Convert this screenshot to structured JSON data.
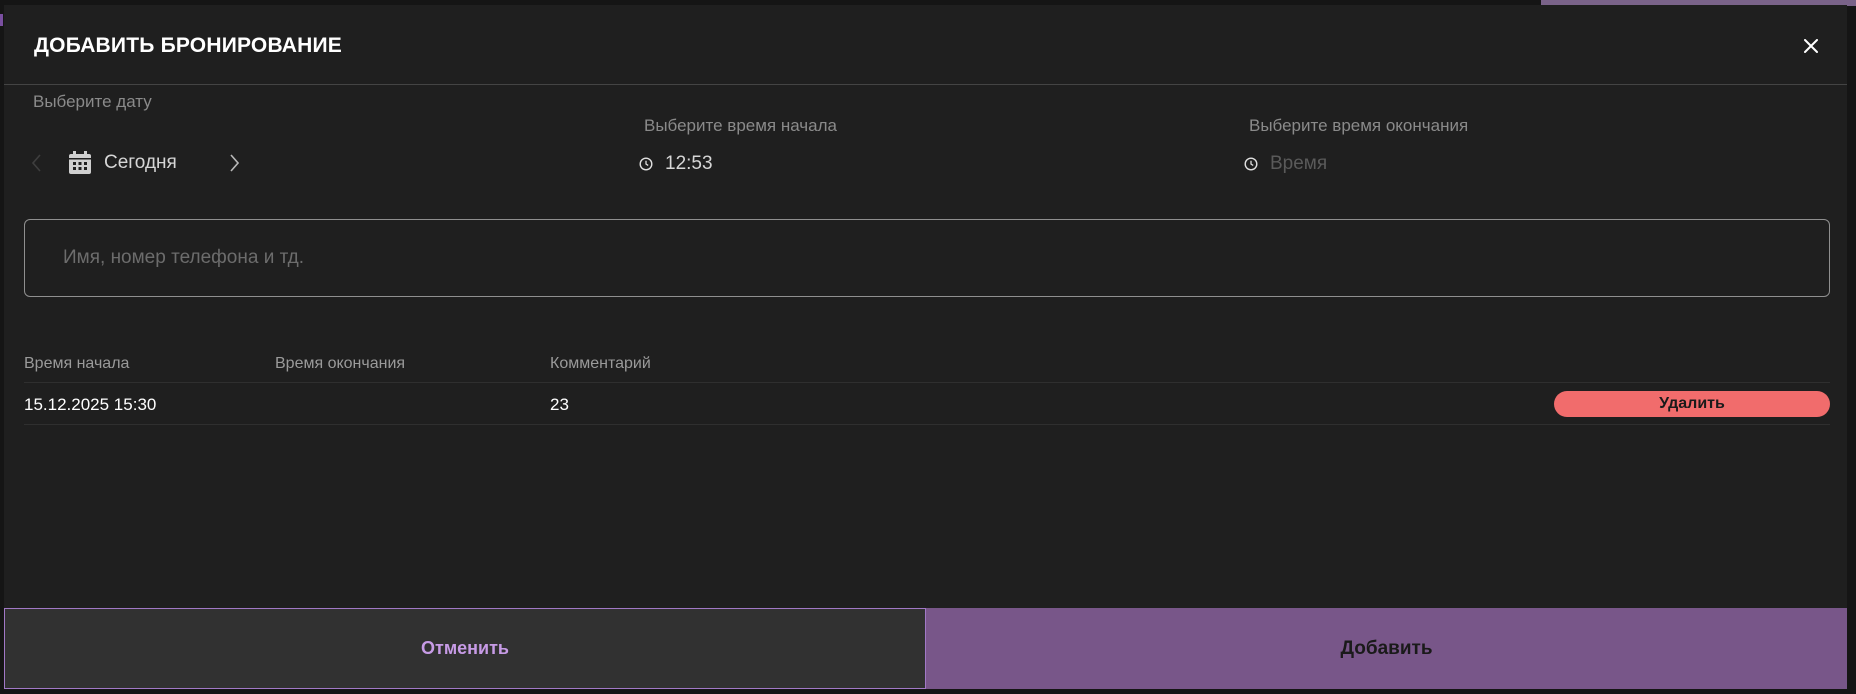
{
  "modal": {
    "title": "ДОБАВИТЬ БРОНИРОВАНИЕ",
    "close_icon": "close-icon"
  },
  "date": {
    "label": "Выберите дату",
    "value": "Сегодня",
    "prev_icon": "chevron-left-icon",
    "next_icon": "chevron-right-icon",
    "calendar_icon": "calendar-icon"
  },
  "start_time": {
    "label": "Выберите время начала",
    "value": "12:53",
    "icon": "clock-icon"
  },
  "end_time": {
    "label": "Выберите время окончания",
    "placeholder": "Время",
    "icon": "clock-icon"
  },
  "search": {
    "placeholder": "Имя, номер телефона и тд."
  },
  "table": {
    "headers": [
      "Время начала",
      "Время окончания",
      "Комментарий"
    ],
    "rows": [
      {
        "start": "15.12.2025 15:30",
        "end": "",
        "comment": "23",
        "action": "Удалить"
      }
    ]
  },
  "footer": {
    "cancel_label": "Отменить",
    "add_label": "Добавить"
  },
  "colors": {
    "accent": "#785689",
    "accent_text": "#c79be6",
    "danger": "#f16c6c",
    "background": "#1f1f1f"
  }
}
